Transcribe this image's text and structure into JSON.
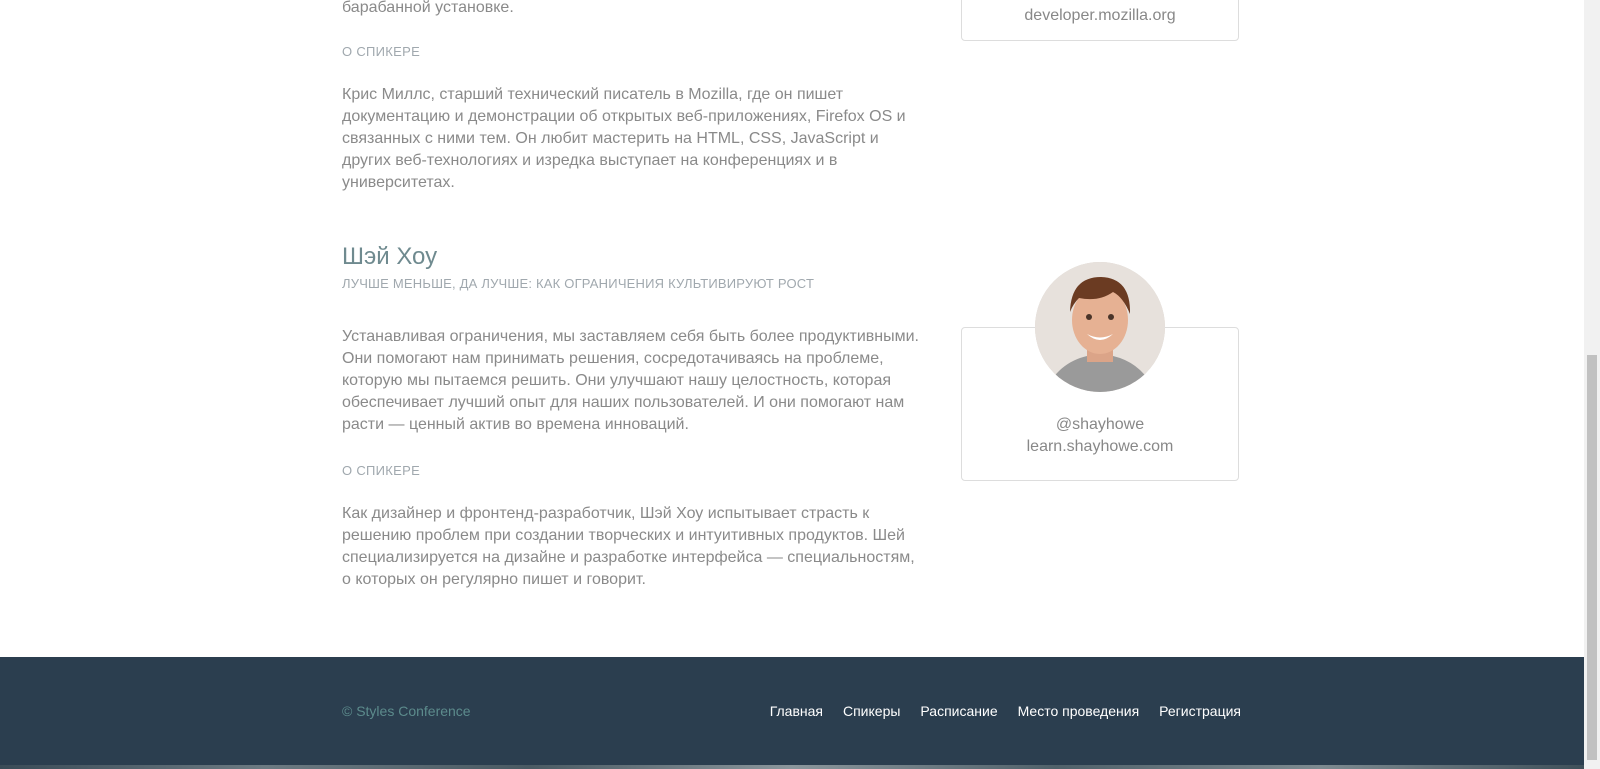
{
  "speaker1": {
    "desc_tail": "барабанной установке.",
    "about_label": "О СПИКЕРЕ",
    "about_text": "Крис Миллс, старший технический писатель в Mozilla, где он пишет документацию и демонстрации об открытых веб-приложениях, Firefox OS и связанных с ними тем. Он любит мастерить на HTML, CSS, JavaScript и других веб-технологиях и изредка выступает на конференциях и в университетах.",
    "card_link": "developer.mozilla.org"
  },
  "speaker2": {
    "name": "Шэй Хоу",
    "talk_title": "ЛУЧШЕ МЕНЬШЕ, ДА ЛУЧШЕ: КАК ОГРАНИЧЕНИЯ КУЛЬТИВИРУЮТ РОСТ",
    "description": "Устанавливая ограничения, мы заставляем себя быть более продуктивными. Они помогают нам принимать решения, сосредотачиваясь на проблеме, которую мы пытаемся решить. Они улучшают нашу целостность, которая обеспечивает лучший опыт для наших пользователей. И они помогают нам расти — ценный актив во времена инноваций.",
    "about_label": "О СПИКЕРЕ",
    "about_text": "Как дизайнер и фронтенд-разработчик, Шэй Хоу испытывает страсть к решению проблем при создании творческих и интуитивных продуктов. Шей специализируется на дизайне и разработке интерфейса — специальностям, о которых он регулярно пишет и говорит.",
    "handle": "@shayhowe",
    "site": "learn.shayhowe.com"
  },
  "footer": {
    "copyright": "© Styles Conference",
    "nav": [
      "Главная",
      "Спикеры",
      "Расписание",
      "Место проведения",
      "Регистрация"
    ]
  }
}
